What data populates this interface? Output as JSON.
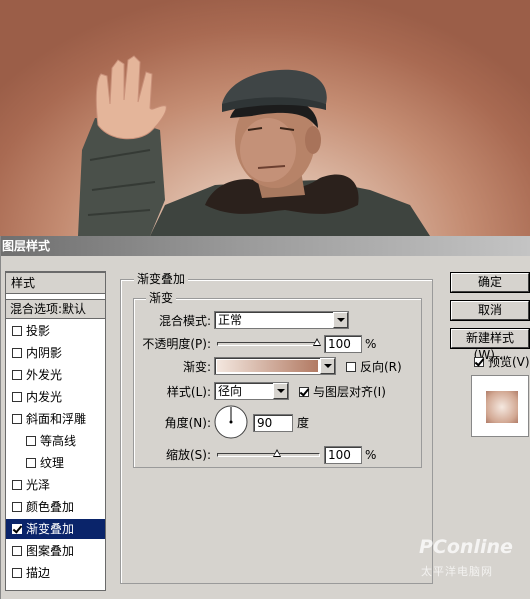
{
  "dialog": {
    "title": "图层样式",
    "styles_header": "样式",
    "blend_options": "混合选项:默认",
    "list": [
      {
        "label": "投影",
        "checked": false,
        "sub": false,
        "selected": false
      },
      {
        "label": "内阴影",
        "checked": false,
        "sub": false,
        "selected": false
      },
      {
        "label": "外发光",
        "checked": false,
        "sub": false,
        "selected": false
      },
      {
        "label": "内发光",
        "checked": false,
        "sub": false,
        "selected": false
      },
      {
        "label": "斜面和浮雕",
        "checked": false,
        "sub": false,
        "selected": false
      },
      {
        "label": "等高线",
        "checked": false,
        "sub": true,
        "selected": false
      },
      {
        "label": "纹理",
        "checked": false,
        "sub": true,
        "selected": false
      },
      {
        "label": "光泽",
        "checked": false,
        "sub": false,
        "selected": false
      },
      {
        "label": "颜色叠加",
        "checked": false,
        "sub": false,
        "selected": false
      },
      {
        "label": "渐变叠加",
        "checked": true,
        "sub": false,
        "selected": true
      },
      {
        "label": "图案叠加",
        "checked": false,
        "sub": false,
        "selected": false
      },
      {
        "label": "描边",
        "checked": false,
        "sub": false,
        "selected": false
      }
    ]
  },
  "panel": {
    "outer_title": "渐变叠加",
    "inner_title": "渐变",
    "blend_mode_label": "混合模式:",
    "blend_mode_value": "正常",
    "opacity_label": "不透明度(P):",
    "opacity_value": "100",
    "opacity_unit": "%",
    "gradient_label": "渐变:",
    "reverse_label": "反向(R)",
    "reverse_checked": false,
    "style_label": "样式(L):",
    "style_value": "径向",
    "align_label": "与图层对齐(I)",
    "align_checked": true,
    "angle_label": "角度(N):",
    "angle_value": "90",
    "angle_unit": "度",
    "scale_label": "缩放(S):",
    "scale_value": "100",
    "scale_unit": "%"
  },
  "buttons": {
    "ok": "确定",
    "cancel": "取消",
    "new_style": "新建样式(W)...",
    "preview_label": "预览(V)",
    "preview_checked": true
  },
  "watermark": {
    "brand": "PConline",
    "sub": "太平洋电脑网"
  },
  "colors": {
    "selected_bg": "#0a246a",
    "dialog_bg": "#d6d3ce",
    "gradient_start": "#f3e7df",
    "gradient_end": "#b27a63"
  }
}
